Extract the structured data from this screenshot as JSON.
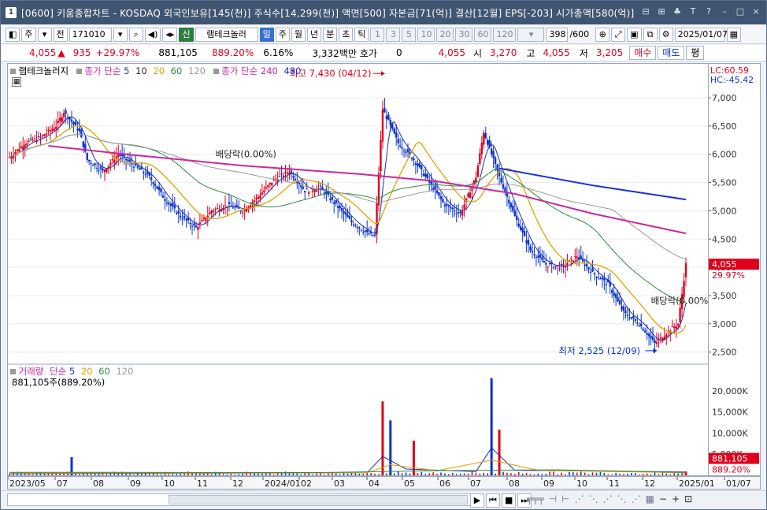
{
  "title": {
    "window_no": "1",
    "text": "[0600] 키움종합차트 - KOSDAQ 외국인보유[145(천)] 주식수[14,299(천)] 액면[500] 자본금[71(억)] 결산[12월] EPS[-203] 시가총액[580(억)]"
  },
  "toolbar": {
    "period_label": "주",
    "prev_label": "전",
    "code": "171010",
    "stock_name": "램테크놀러",
    "stock_tag": "신",
    "tf_day": "일",
    "tf_week": "주",
    "tf_month": "월",
    "tf_year": "년",
    "tf_min": "분",
    "tf_sec": "초",
    "tf_tick": "틱",
    "intervals": [
      "1",
      "3",
      "5",
      "10",
      "20",
      "30",
      "60",
      "120"
    ],
    "count": "398",
    "count_max": "/600",
    "date": "2025/01/07"
  },
  "quote": {
    "price": "4,055",
    "change": "935",
    "change_pct": "+29.97%",
    "volume": "881,105",
    "volume_ratio": "889.20%",
    "turnover": "6.16%",
    "amount": "3,332백만",
    "hoga_label": "호가",
    "hoga": "0",
    "hoga_price": "4,055",
    "open_label": "시",
    "open": "3,270",
    "high_label": "고",
    "high": "4,055",
    "low_label": "저",
    "low": "3,205",
    "buy": "매수",
    "sell": "매도",
    "eval": "평"
  },
  "legend": {
    "stock": "램테크놀러지",
    "ma_label": "종가 단순",
    "ma_periods": [
      "5",
      "10",
      "20",
      "60",
      "120"
    ],
    "ma_long_label": "종가 단순",
    "ma_long_periods": [
      "240",
      "480"
    ],
    "vol_label": "거래량",
    "vol_ma_label": "단순",
    "vol_ma_periods": [
      "5",
      "20",
      "60",
      "120"
    ],
    "vol_value": "881,105주(889.20%)"
  },
  "annotations": {
    "high": "최고 7,430 (04/12)",
    "low": "최저 2,525 (12/09)",
    "div1": "배당락(0.00%)",
    "div2": "배당락(0.00%)"
  },
  "price_axis": {
    "lc": "LC:60.59",
    "hc": "HC:-45.42",
    "ticks": [
      "7,000",
      "6,500",
      "6,000",
      "5,500",
      "5,000",
      "4,500",
      "4,000",
      "3,500",
      "3,000",
      "2,500"
    ],
    "last": "4,055",
    "last_pct": "29.97%",
    "vol_ticks": [
      "20,000K",
      "15,000K",
      "10,000K",
      "5,000K"
    ],
    "vol_last": "881,105",
    "vol_pct": "889.20%"
  },
  "xaxis": {
    "labels": [
      "2023/05",
      "07",
      "08",
      "09",
      "10",
      "11",
      "12",
      "2024/01",
      "02",
      "03",
      "04",
      "05",
      "06",
      "07",
      "08",
      "09",
      "10",
      "11",
      "12",
      "2025/01",
      "01/07"
    ]
  },
  "colors": {
    "up": "#e0001b",
    "down": "#0b33c9",
    "ma5": "#1c2fb8",
    "ma20": "#e0a200",
    "ma60": "#2e8b3f",
    "ma120": "#9a9a9a",
    "ma240": "#c8289f",
    "ma480": "#1a2fd6"
  },
  "chart_data": {
    "type": "candlestick",
    "ylim": [
      2300,
      7600
    ],
    "price_path": [
      [
        0,
        5950
      ],
      [
        2,
        6200
      ],
      [
        4,
        6300
      ],
      [
        6,
        6500
      ],
      [
        7,
        6750
      ],
      [
        9,
        6400
      ],
      [
        10,
        5900
      ],
      [
        12,
        5700
      ],
      [
        14,
        6000
      ],
      [
        16,
        5800
      ],
      [
        18,
        5600
      ],
      [
        20,
        5200
      ],
      [
        22,
        4900
      ],
      [
        24,
        4700
      ],
      [
        26,
        5000
      ],
      [
        28,
        5100
      ],
      [
        30,
        5000
      ],
      [
        32,
        5250
      ],
      [
        34,
        5550
      ],
      [
        36,
        5700
      ],
      [
        38,
        5350
      ],
      [
        40,
        5400
      ],
      [
        42,
        5100
      ],
      [
        44,
        4800
      ],
      [
        46,
        4600
      ],
      [
        47,
        4550
      ],
      [
        48,
        6800
      ],
      [
        50,
        6200
      ],
      [
        52,
        5900
      ],
      [
        54,
        5500
      ],
      [
        56,
        5100
      ],
      [
        58,
        4950
      ],
      [
        60,
        5600
      ],
      [
        61,
        6400
      ],
      [
        63,
        5600
      ],
      [
        65,
        4900
      ],
      [
        67,
        4300
      ],
      [
        69,
        4050
      ],
      [
        71,
        4000
      ],
      [
        73,
        4200
      ],
      [
        75,
        3900
      ],
      [
        77,
        3700
      ],
      [
        79,
        3200
      ],
      [
        81,
        3000
      ],
      [
        83,
        2650
      ],
      [
        85,
        2900
      ],
      [
        86,
        3000
      ],
      [
        87,
        4055
      ]
    ],
    "volume_spikes": [
      [
        8,
        4300
      ],
      [
        48,
        17500
      ],
      [
        49,
        13000
      ],
      [
        52,
        8200
      ],
      [
        62,
        23000
      ],
      [
        63,
        10800
      ],
      [
        87,
        881
      ]
    ]
  }
}
